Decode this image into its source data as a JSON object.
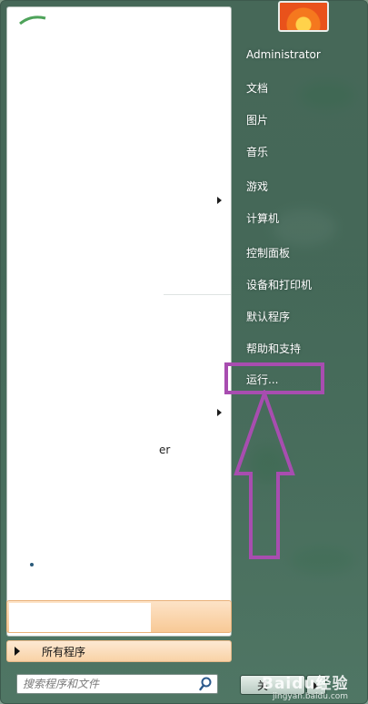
{
  "user": {
    "name": "Administrator"
  },
  "right_menu": {
    "items": [
      {
        "label": "文档"
      },
      {
        "label": "图片"
      },
      {
        "label": "音乐"
      },
      {
        "label": "游戏"
      },
      {
        "label": "计算机"
      },
      {
        "label": "控制面板"
      },
      {
        "label": "设备和打印机"
      },
      {
        "label": "默认程序"
      },
      {
        "label": "帮助和支持"
      },
      {
        "label": "运行..."
      }
    ]
  },
  "left_pane": {
    "fragment_text": "er",
    "all_programs_label": "所有程序"
  },
  "search": {
    "placeholder": "搜索程序和文件"
  },
  "shutdown": {
    "label": "关"
  },
  "watermark": {
    "brand": "Baidu经验",
    "sub": "jingyan.baidu.com"
  },
  "colors": {
    "annotation": "#a84db0",
    "highlight": "#f8c996"
  }
}
